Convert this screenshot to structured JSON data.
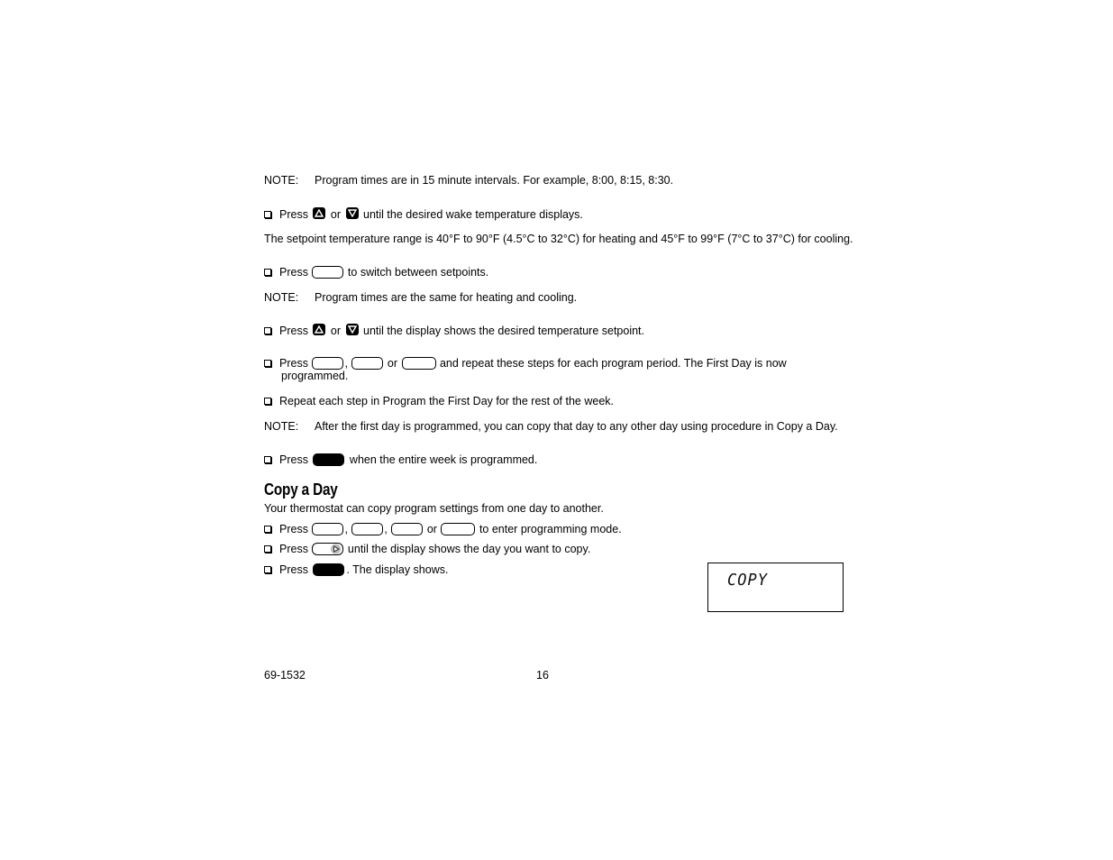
{
  "notes": {
    "label": "NOTE:",
    "intervals": "Program times are in 15 minute intervals. For example, 8:00, 8:15, 8:30.",
    "same_times": "Program times are the same for heating and cooling.",
    "copy_hint": "After the first day is programmed, you can copy that day to any other day using procedure in Copy a Day."
  },
  "steps": {
    "press": "Press",
    "or": "or",
    "comma": ",",
    "wake_temp": "until the desired wake temperature displays.",
    "range_text": "The setpoint temperature range is 40°F to 90°F (4.5°C to 32°C) for heating and 45°F to 99°F (7°C to 37°C) for cooling.",
    "switch_setpoints": "to switch between setpoints.",
    "display_setpoint": "until the display shows the desired temperature setpoint.",
    "repeat_period": "and repeat these steps for each program period. The First Day is now",
    "repeat_period_cont": "programmed.",
    "repeat_week": "Repeat each step in Program the First Day for the rest of the week.",
    "entire_week": "when the entire week is programmed."
  },
  "copy_section": {
    "title": "Copy a Day",
    "intro": "Your thermostat can copy program settings from one day to another.",
    "enter_mode": "to enter programming mode.",
    "select_day": "until the display shows the day you want to copy.",
    "display_shows": ". The display shows.",
    "lcd_text": "COPY"
  },
  "footer": {
    "doc_number": "69-1532",
    "page_number": "16"
  }
}
